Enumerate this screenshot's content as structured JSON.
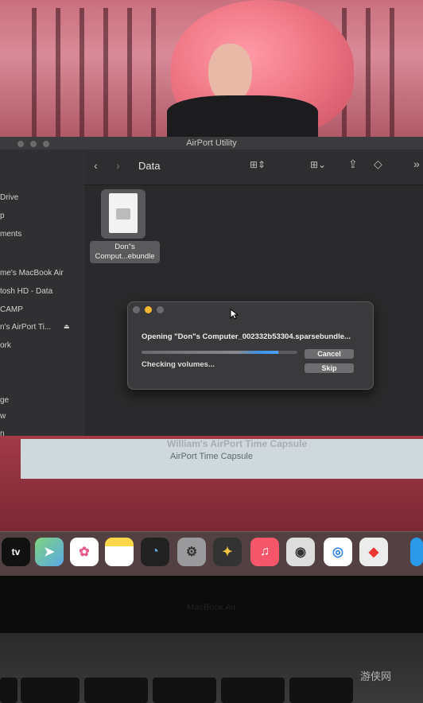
{
  "finder": {
    "window_title": "AirPort Utility",
    "folder_title": "Data",
    "sidebar": [
      "Drive",
      "p",
      "ments",
      "me's MacBook Air",
      "tosh HD - Data",
      "CAMP",
      "n's AirPort Ti...",
      "ork",
      "ge",
      "w",
      "n"
    ],
    "file_name_line1": "Don\"s",
    "file_name_line2": "Comput...ebundle"
  },
  "dialog": {
    "opening_text": "Opening \"Don\"s Computer_002332b53304.sparsebundle...",
    "status_text": "Checking volumes...",
    "progress": 0.88,
    "cancel_label": "Cancel",
    "skip_label": "Skip"
  },
  "airport": {
    "device_title": "William's AirPort Time Capsule",
    "device_subtitle": "AirPort Time Capsule"
  },
  "dock": {
    "apps": [
      "tv-icon",
      "maps-icon",
      "photos-icon",
      "notes-icon",
      "speedtest-icon",
      "system-preferences-icon",
      "davinci-resolve-icon",
      "music-icon",
      "pokeball-icon",
      "safari-icon",
      "roblox-icon"
    ],
    "tv_label": "tv"
  },
  "bezel": {
    "label": "MacBook Air"
  },
  "watermark": "游侠网",
  "colors": {
    "accent_blue": "#3d8fe0",
    "dialog_bg": "#3a3a3c",
    "button_bg": "#6e6e70"
  }
}
